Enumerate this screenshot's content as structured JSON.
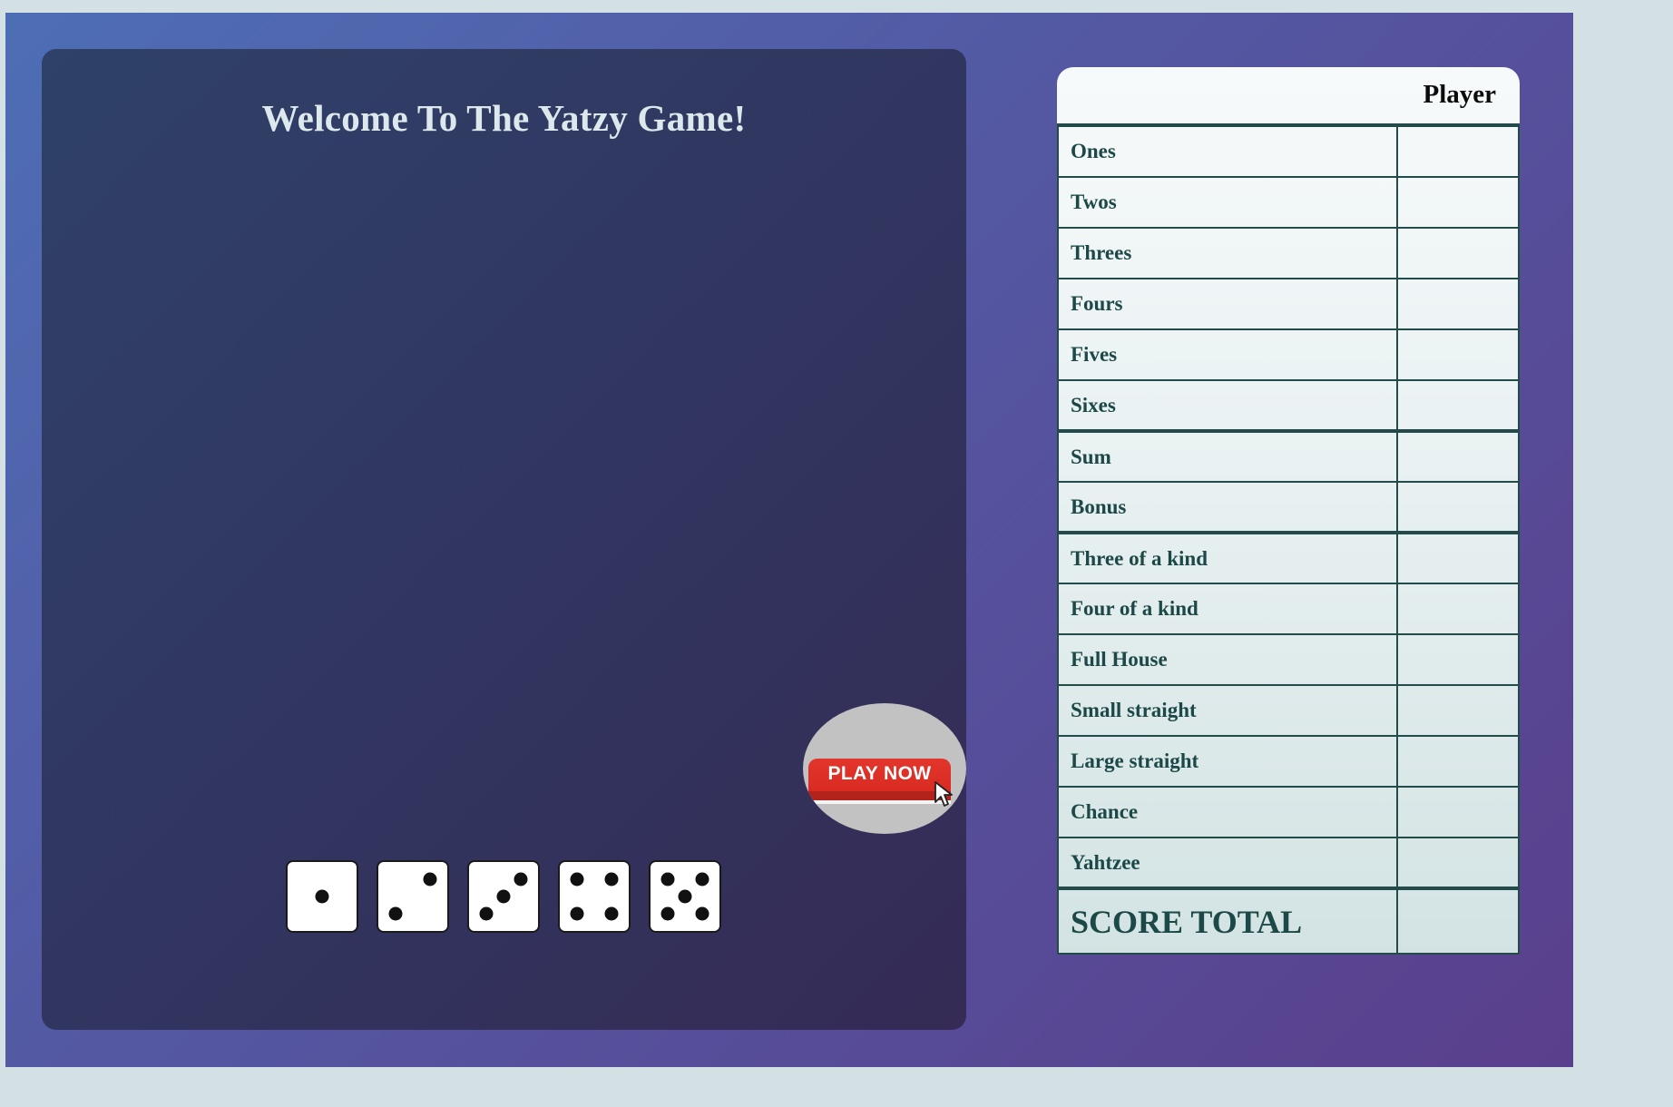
{
  "game": {
    "welcome": "Welcome To The Yatzy Game!",
    "play_button": "PLAY NOW",
    "dice": [
      1,
      2,
      3,
      4,
      5
    ]
  },
  "scorecard": {
    "player_header": "Player",
    "rows": [
      {
        "label": "Ones",
        "value": ""
      },
      {
        "label": "Twos",
        "value": ""
      },
      {
        "label": "Threes",
        "value": ""
      },
      {
        "label": "Fours",
        "value": ""
      },
      {
        "label": "Fives",
        "value": ""
      },
      {
        "label": "Sixes",
        "value": ""
      },
      {
        "label": "Sum",
        "value": ""
      },
      {
        "label": "Bonus",
        "value": ""
      },
      {
        "label": "Three of a kind",
        "value": ""
      },
      {
        "label": "Four of a kind",
        "value": ""
      },
      {
        "label": "Full House",
        "value": ""
      },
      {
        "label": "Small straight",
        "value": ""
      },
      {
        "label": "Large straight",
        "value": ""
      },
      {
        "label": "Chance",
        "value": ""
      },
      {
        "label": "Yahtzee",
        "value": ""
      }
    ],
    "total_label": "SCORE TOTAL",
    "total_value": ""
  },
  "colors": {
    "play_button": "#e2352b",
    "scorecard_text": "#1c4947",
    "board_background": "#31355f"
  }
}
